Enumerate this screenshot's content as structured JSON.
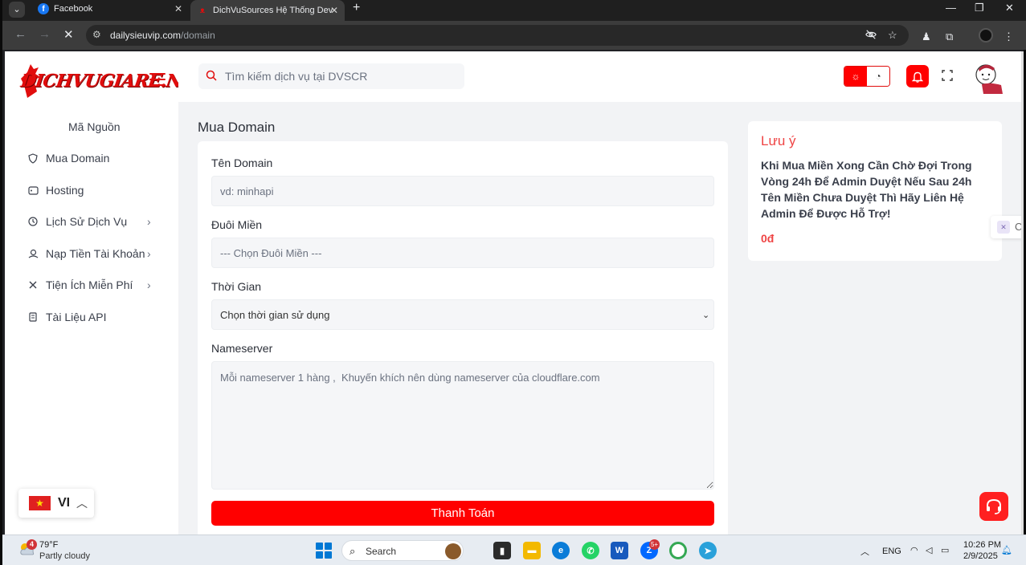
{
  "browser": {
    "tabs": [
      {
        "title": "Facebook",
        "active": false
      },
      {
        "title": "DichVuSources Hệ Thống Dev",
        "active": true
      }
    ],
    "url_host": "dailysieuvip.com",
    "url_path": "/domain"
  },
  "site": {
    "logo_text": "DICHVUGIARE.NET",
    "search_placeholder": "Tìm kiếm dịch vụ tại DVSCR"
  },
  "sidebar": {
    "items": [
      {
        "label": "Mã Nguồn",
        "icon": "none",
        "has_submenu": false
      },
      {
        "label": "Mua Domain",
        "icon": "shield-icon",
        "has_submenu": false
      },
      {
        "label": "Hosting",
        "icon": "server-icon",
        "has_submenu": false
      },
      {
        "label": "Lịch Sử Dịch Vụ",
        "icon": "history-icon",
        "has_submenu": true
      },
      {
        "label": "Nạp Tiền Tài Khoản",
        "icon": "wallet-icon",
        "has_submenu": true
      },
      {
        "label": "Tiện Ích Miễn Phí",
        "icon": "tools-icon",
        "has_submenu": true
      },
      {
        "label": "Tài Liệu API",
        "icon": "document-icon",
        "has_submenu": false
      }
    ],
    "language": "VI"
  },
  "main": {
    "page_title": "Mua Domain",
    "form": {
      "domain_label": "Tên Domain",
      "domain_placeholder": "vd: minhapi",
      "extension_label": "Đuôi Miền",
      "extension_placeholder": "--- Chọn Đuôi Miền ---",
      "duration_label": "Thời Gian",
      "duration_selected": "Chọn thời gian sử dụng",
      "nameserver_label": "Nameserver",
      "nameserver_placeholder": "Mỗi nameserver 1 hàng ,  Khuyến khích nên dùng nameserver của cloudflare.com",
      "submit_label": "Thanh Toán"
    },
    "note": {
      "title": "Lưu ý",
      "body": "Khi Mua Miền Xong Cần Chờ Đợi Trong Vòng 24h Để Admin Duyệt Nếu Sau 24h Tên Miền Chưa Duyệt Thì Hãy Liên Hệ Admin Để Được Hỗ Trợ!",
      "amount": "0đ"
    },
    "side_widget_text": "C"
  },
  "taskbar": {
    "weather_temp": "79°F",
    "weather_condition": "Partly cloudy",
    "weather_badge": "4",
    "search_label": "Search",
    "zalo_badge": "5+",
    "language": "ENG",
    "time": "10:26 PM",
    "date": "2/9/2025"
  },
  "colors": {
    "brand_red": "#ff0000",
    "note_red": "#ef4444",
    "page_bg": "#f2f3f5"
  }
}
